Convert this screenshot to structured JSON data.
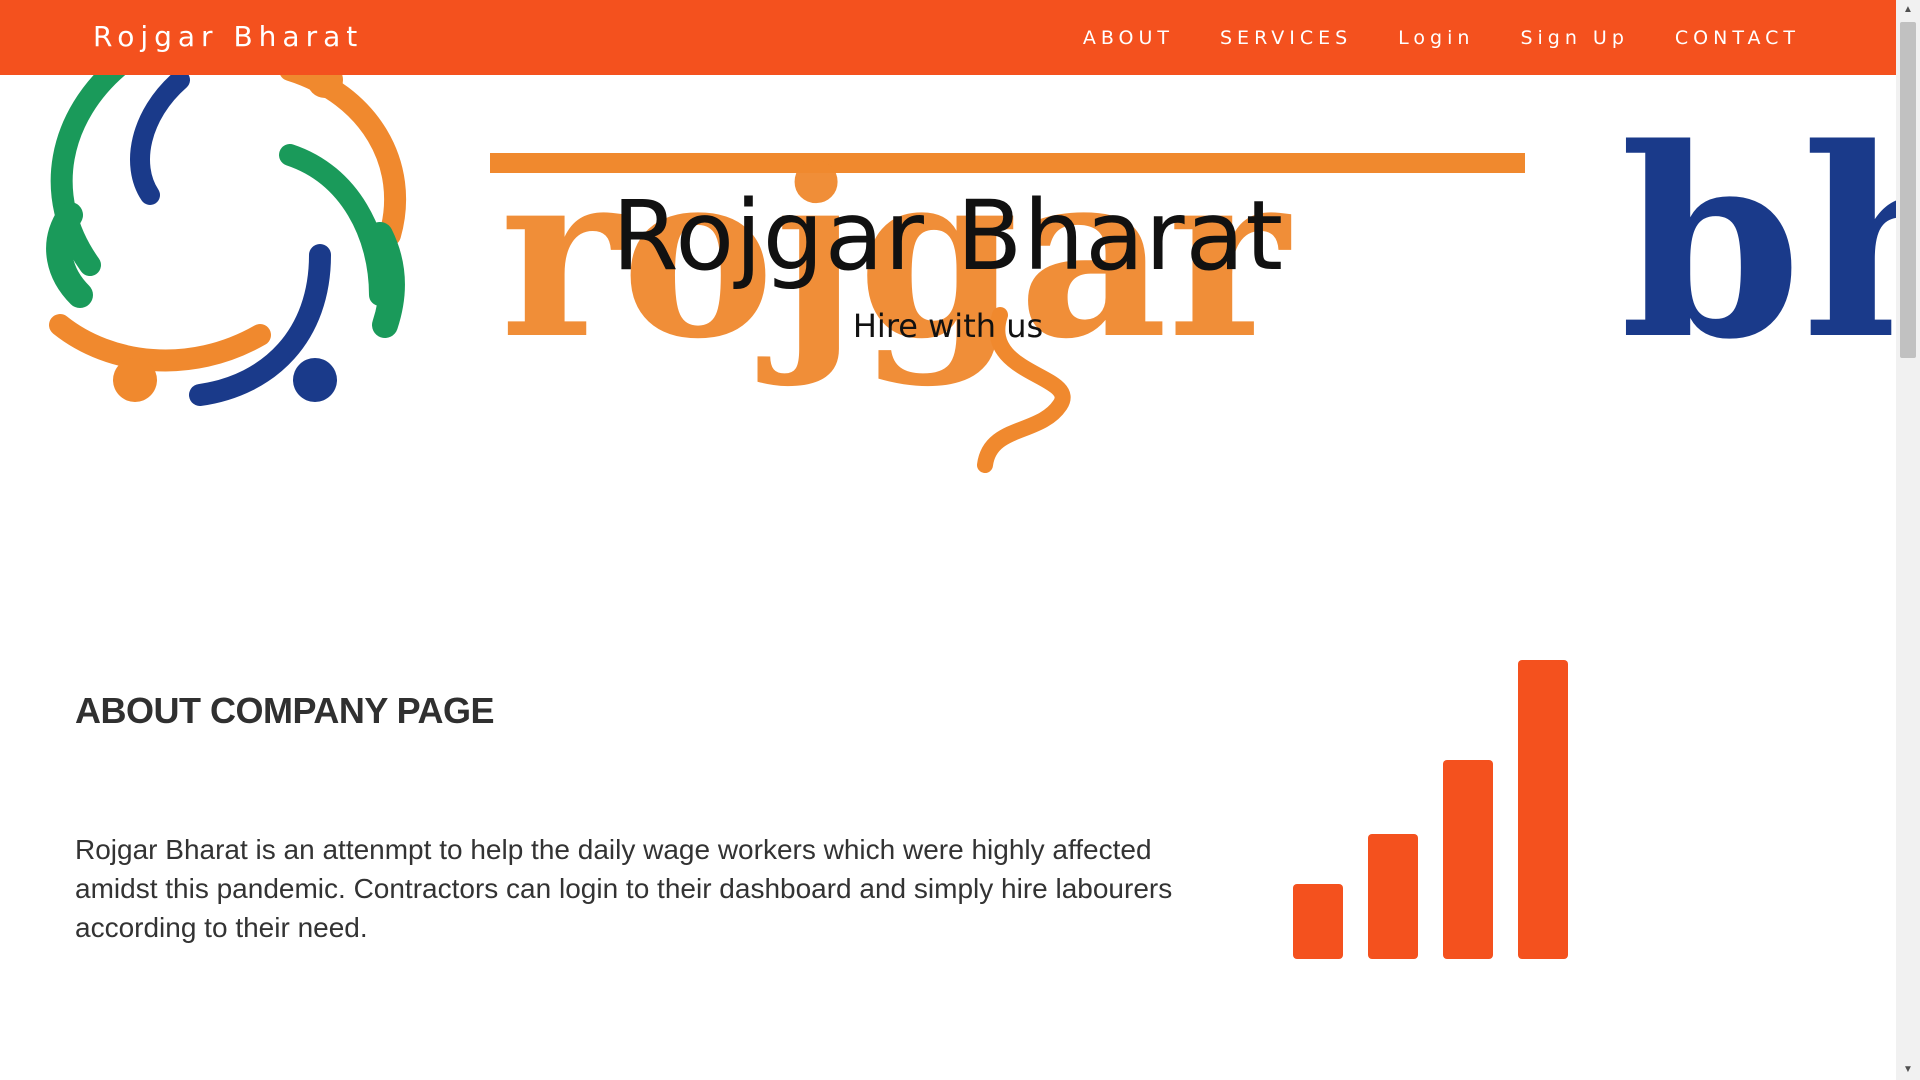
{
  "navbar": {
    "brand": "Rojgar Bharat",
    "links": [
      "ABOUT",
      "SERVICES",
      "Login",
      "Sign Up",
      "CONTACT"
    ],
    "color": "#f4511e"
  },
  "hero": {
    "title": "Rojgar Bharat",
    "subtitle": "Hire with us",
    "logo_text": "rojgar",
    "logo_text_2": "bh"
  },
  "about": {
    "heading": "ABOUT COMPANY PAGE",
    "text": "Rojgar Bharat is an attenmpt to help the daily wage workers which were highly affected amidst this pandemic. Contractors can login to their dashboard and simply hire labourers according to their need.",
    "icon": "signal-icon"
  },
  "colors": {
    "accent": "#f4511e",
    "logo_orange": "#f0892e",
    "logo_blue": "#1a3a8a",
    "logo_green": "#1a9a5a"
  }
}
